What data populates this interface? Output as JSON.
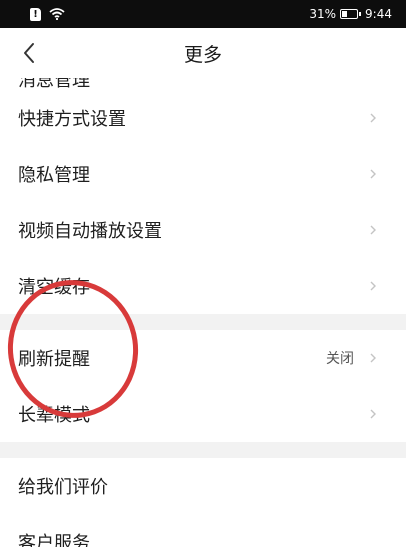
{
  "status_bar": {
    "sim_label": "!",
    "battery_percent_text": "31%",
    "battery_level": 0.31,
    "time": "9:44"
  },
  "nav": {
    "title": "更多",
    "back_icon": "chevron-left-icon"
  },
  "list": {
    "partial_top_label": "消息管理",
    "group1": [
      {
        "label": "快捷方式设置"
      },
      {
        "label": "隐私管理"
      },
      {
        "label": "视频自动播放设置"
      },
      {
        "label": "清空缓存"
      }
    ],
    "group2": [
      {
        "label": "刷新提醒",
        "value": "关闭"
      },
      {
        "label": "长辈模式"
      }
    ],
    "group3": [
      {
        "label": "给我们评价"
      },
      {
        "label": "客户服务"
      }
    ]
  },
  "colors": {
    "status_bg": "#0d0d0d",
    "section_gap": "#f2f2f2",
    "annotation_circle": "#d83a3a",
    "chevron": "#c4c4c4"
  }
}
